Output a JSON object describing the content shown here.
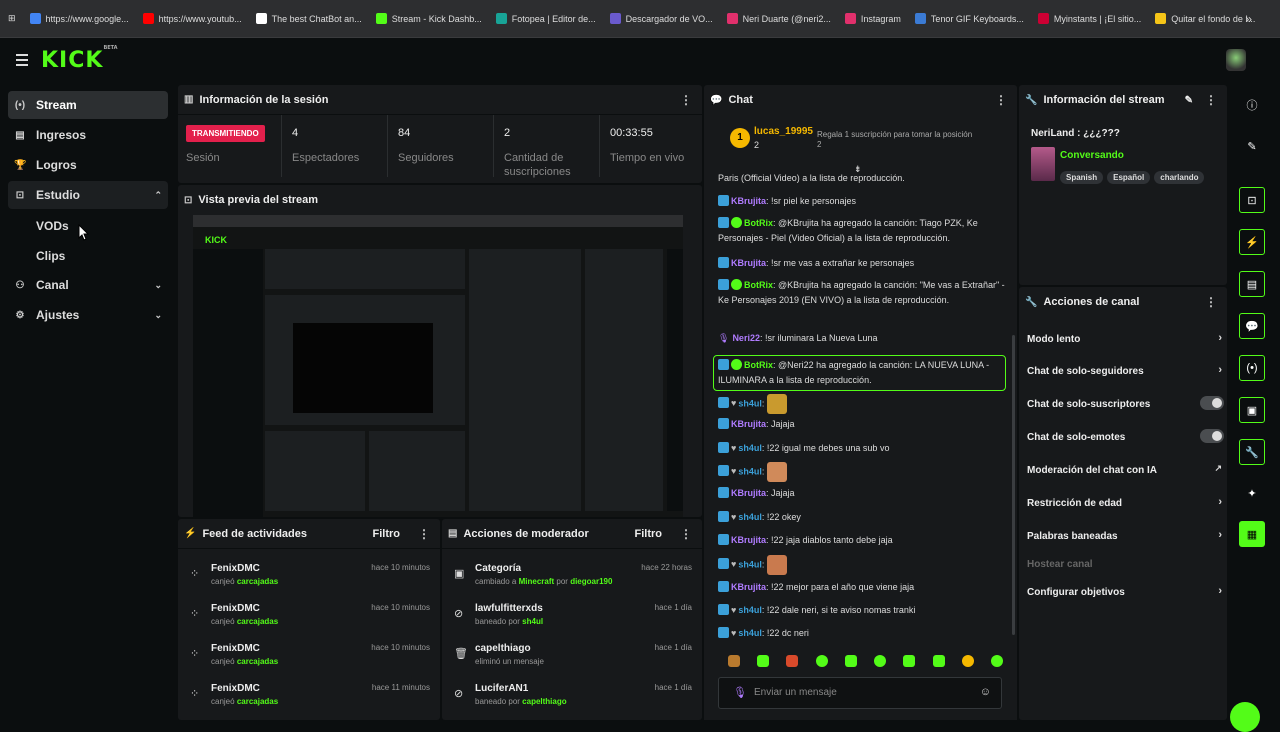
{
  "bookmarks": [
    {
      "label": "https://www.google...",
      "color": "#4285f4"
    },
    {
      "label": "https://www.youtub...",
      "color": "#ff0000"
    },
    {
      "label": "The best ChatBot an...",
      "color": "#ffffff"
    },
    {
      "label": "Stream - Kick Dashb...",
      "color": "#53fc18"
    },
    {
      "label": "Fotopea | Editor de...",
      "color": "#18a497"
    },
    {
      "label": "Descargador de VO...",
      "color": "#6a5acd"
    },
    {
      "label": "Neri Duarte (@neri2...",
      "color": "#e1306c"
    },
    {
      "label": "Instagram",
      "color": "#e1306c"
    },
    {
      "label": "Tenor GIF Keyboards...",
      "color": "#3b7bd4"
    },
    {
      "label": "Myinstants | ¡El sitio...",
      "color": "#cc0033"
    },
    {
      "label": "Quitar el fondo de I...",
      "color": "#f5c518"
    }
  ],
  "bookmarks_more": "»",
  "logo": {
    "text": "KICK",
    "sup": "BETA"
  },
  "sidebar": {
    "items": [
      {
        "label": "Stream",
        "icon": "(•)"
      },
      {
        "label": "Ingresos",
        "icon": "▤"
      },
      {
        "label": "Logros",
        "icon": "🏆"
      },
      {
        "label": "Estudio",
        "icon": "⊡",
        "chevron": "⌃"
      },
      {
        "label": "Canal",
        "icon": "⚇",
        "chevron": "⌄"
      },
      {
        "label": "Ajustes",
        "icon": "⚙",
        "chevron": "⌄"
      }
    ],
    "subitems": [
      "VODs",
      "Clips"
    ]
  },
  "session": {
    "title": "Información de la sesión",
    "badge": "TRANSMITIENDO",
    "badge_label": "Sesión",
    "stats": [
      {
        "value": "4",
        "label": "Espectadores"
      },
      {
        "value": "84",
        "label": "Seguidores"
      },
      {
        "value": "2",
        "label": "Cantidad de suscripciones"
      },
      {
        "value": "00:33:55",
        "label": "Tiempo en vivo"
      }
    ]
  },
  "preview": {
    "title": "Vista previa del stream"
  },
  "feed": {
    "title": "Feed de actividades",
    "filter": "Filtro",
    "rows": [
      {
        "name": "FenixDMC",
        "desc": "canjeó",
        "item": "carcajadas",
        "time": "hace 10 minutos"
      },
      {
        "name": "FenixDMC",
        "desc": "canjeó",
        "item": "carcajadas",
        "time": "hace 10 minutos"
      },
      {
        "name": "FenixDMC",
        "desc": "canjeó",
        "item": "carcajadas",
        "time": "hace 10 minutos"
      },
      {
        "name": "FenixDMC",
        "desc": "canjeó",
        "item": "carcajadas",
        "time": "hace 11 minutos"
      }
    ]
  },
  "mod": {
    "title": "Acciones de moderador",
    "filter": "Filtro",
    "rows": [
      {
        "name": "Categoría",
        "desc": "cambiado a",
        "item": "Minecraft",
        "extra": "por",
        "item2": "diegoar190",
        "time": "hace 22 horas"
      },
      {
        "name": "lawfulfitterxds",
        "desc": "baneado por",
        "item": "sh4ul",
        "time": "hace 1 día"
      },
      {
        "name": "capelthiago",
        "desc": "eliminó un mensaje",
        "item": "",
        "time": "hace 1 día"
      },
      {
        "name": "LuciferAN1",
        "desc": "baneado por",
        "item": "capelthiago",
        "time": "hace 1 día"
      }
    ]
  },
  "chat": {
    "title": "Chat",
    "gift_user": "lucas_19995",
    "gift_count": "2",
    "gift_rank": "1",
    "gift_text": "Regala 1 suscripción para tomar la posición 2",
    "top_line": "Paris (Official Video) a la lista de reproducción.",
    "messages": [
      {
        "user": "KBrujita",
        "color": "#b07cff",
        "text": ": !sr piel ke personajes"
      },
      {
        "user": "BotRix",
        "color": "#53fc18",
        "text": ": @KBrujita ha agregado la canción: Tiago PZK, Ke Personajes - Piel (Video Oficial) a la lista de reproducción."
      },
      {
        "user": "KBrujita",
        "color": "#b07cff",
        "text": ": !sr me vas a extrañar ke personajes"
      },
      {
        "user": "BotRix",
        "color": "#53fc18",
        "text": ": @KBrujita ha agregado la canción: \"Me vas a Extrañar\" - Ke Personajes 2019 (EN VIVO) a la lista de reproducción."
      },
      {
        "user": "Neri22",
        "color": "#b07cff",
        "text": ": !sr iluminara La Nueva Luna"
      },
      {
        "user": "BotRix",
        "color": "#53fc18",
        "text": ": @Neri22 ha agregado la canción: LA NUEVA LUNA - ILUMINARA a la lista de reproducción."
      },
      {
        "user": "sh4ul",
        "color": "#3ba0d9",
        "text": ":"
      },
      {
        "user": "KBrujita",
        "color": "#b07cff",
        "text": ": Jajaja"
      },
      {
        "user": "sh4ul",
        "color": "#3ba0d9",
        "text": ": !22 igual me debes una sub vo"
      },
      {
        "user": "sh4ul",
        "color": "#3ba0d9",
        "text": ":"
      },
      {
        "user": "KBrujita",
        "color": "#b07cff",
        "text": ": Jajaja"
      },
      {
        "user": "sh4ul",
        "color": "#3ba0d9",
        "text": ": !22 okey"
      },
      {
        "user": "KBrujita",
        "color": "#b07cff",
        "text": ": !22 jaja diablos tanto debe jaja"
      },
      {
        "user": "sh4ul",
        "color": "#3ba0d9",
        "text": ":"
      },
      {
        "user": "KBrujita",
        "color": "#b07cff",
        "text": ": !22 mejor para el año que viene jaja"
      },
      {
        "user": "sh4ul",
        "color": "#3ba0d9",
        "text": ": !22 dale neri, si te aviso nomas tranki"
      },
      {
        "user": "sh4ul",
        "color": "#3ba0d9",
        "text": ": !22 dc neri"
      }
    ],
    "input_placeholder": "Enviar un mensaje"
  },
  "stream_info": {
    "title": "Información del stream",
    "stream_title": "NeriLand : ¿¿¿???",
    "category": "Conversando",
    "tags": [
      "Spanish",
      "Español",
      "charlando"
    ]
  },
  "channel_actions": {
    "title": "Acciones de canal",
    "items": [
      {
        "label": "Modo lento",
        "type": "chevron"
      },
      {
        "label": "Chat de solo-seguidores",
        "type": "chevron"
      },
      {
        "label": "Chat de solo-suscriptores",
        "type": "toggle"
      },
      {
        "label": "Chat de solo-emotes",
        "type": "toggle"
      },
      {
        "label": "Moderación del chat con IA",
        "type": "external"
      },
      {
        "label": "Restricción de edad",
        "type": "chevron"
      },
      {
        "label": "Palabras baneadas",
        "type": "chevron"
      },
      {
        "label": "Hostear canal",
        "type": "disabled"
      },
      {
        "label": "Configurar objetivos",
        "type": "chevron"
      }
    ]
  },
  "accent": "#53fc18"
}
